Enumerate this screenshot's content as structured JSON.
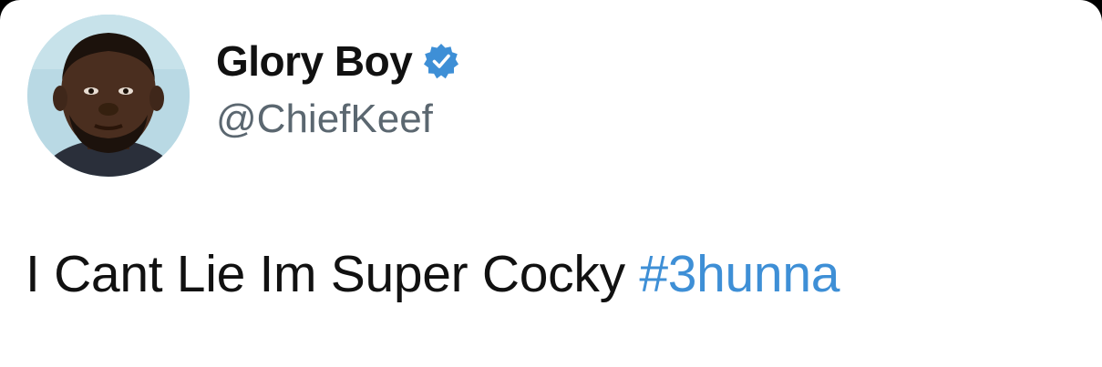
{
  "tweet": {
    "author": {
      "display_name": "Glory Boy",
      "handle": "@ChiefKeef",
      "verified": true,
      "avatar_icon": "profile-photo"
    },
    "text": "I Cant Lie Im Super Cocky",
    "hashtag": "#3hunna"
  },
  "colors": {
    "hashtag": "#3e8fd6",
    "verified_badge": "#3e8fd6",
    "text": "#111111",
    "handle": "#5b6770",
    "avatar_background": "#b9d9e4"
  }
}
